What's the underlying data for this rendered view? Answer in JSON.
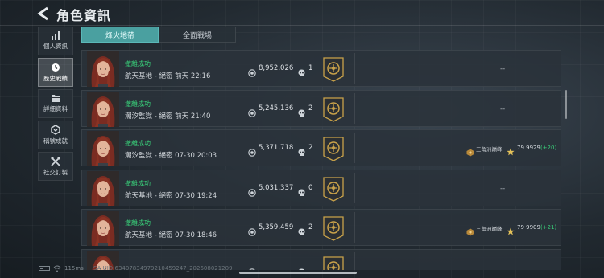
{
  "header": {
    "title": "角色資訊"
  },
  "sidebar": {
    "items": [
      {
        "label": "個人資訊",
        "icon": "bar-chart-icon",
        "active": false
      },
      {
        "label": "歷史戰績",
        "icon": "history-clock-icon",
        "active": true
      },
      {
        "label": "詳細資料",
        "icon": "folder-icon",
        "active": false
      },
      {
        "label": "稱號成就",
        "icon": "achievement-badge-icon",
        "active": false
      },
      {
        "label": "社交訂製",
        "icon": "tools-icon",
        "active": false
      }
    ]
  },
  "tabs": [
    {
      "label": "烽火地帶",
      "active": true
    },
    {
      "label": "全面戰場",
      "active": false
    }
  ],
  "records": [
    {
      "status": "撤離成功",
      "map_line": "航天基地 - 絕密 前天 22:16",
      "coins": "8,952,026",
      "kills": "1",
      "rank": null,
      "dash": "--"
    },
    {
      "status": "撤離成功",
      "map_line": "潮汐監獄 - 絕密 前天 21:40",
      "coins": "5,245,136",
      "kills": "2",
      "rank": null,
      "dash": "--"
    },
    {
      "status": "撤離成功",
      "map_line": "潮汐監獄 - 絕密 07-30 20:03",
      "coins": "5,371,718",
      "kills": "2",
      "rank": {
        "name": "三角洲巔峰",
        "score": "79  9929",
        "delta": "(+20)"
      },
      "dash": null
    },
    {
      "status": "撤離成功",
      "map_line": "航天基地 - 絕密 07-30 19:24",
      "coins": "5,031,337",
      "kills": "0",
      "rank": null,
      "dash": "--"
    },
    {
      "status": "撤離成功",
      "map_line": "航天基地 - 絕密 07-30 18:46",
      "coins": "5,359,459",
      "kills": "2",
      "rank": {
        "name": "三角洲巔峰",
        "score": "79  9909",
        "delta": "(+21)"
      },
      "dash": null
    },
    {
      "status": "",
      "map_line": "",
      "coins": "",
      "kills": "",
      "rank": null,
      "dash": null
    }
  ],
  "footer": {
    "ping": "115ms",
    "uid": "SA UID:6340783497921045924​7_202608021209"
  },
  "colors": {
    "accent_tab": "#4aa0a0",
    "status_success": "#39d07a",
    "medal_gold": "#c9a24a"
  }
}
